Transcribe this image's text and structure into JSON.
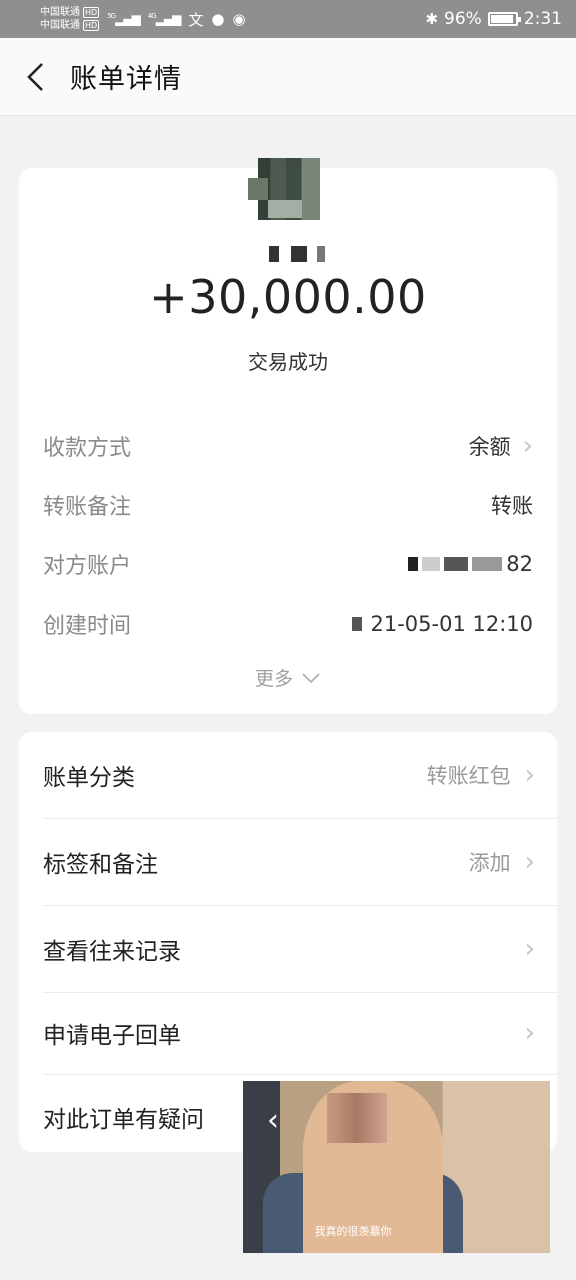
{
  "status_bar": {
    "carrier1": "中国联通",
    "carrier2": "中国联通",
    "hd": "HD",
    "sig1": "5G",
    "sig2": "4G",
    "battery": "96%",
    "time": "2:31"
  },
  "header": {
    "title": "账单详情"
  },
  "summary": {
    "amount": "+30,000.00",
    "status": "交易成功"
  },
  "details": [
    {
      "label": "收款方式",
      "value": "余额"
    },
    {
      "label": "转账备注",
      "value": "转账"
    },
    {
      "label": "对方账户",
      "value": "82"
    },
    {
      "label": "创建时间",
      "value": "21-05-01 12:10"
    }
  ],
  "more_label": "更多",
  "actions": [
    {
      "label": "账单分类",
      "value": "转账红包"
    },
    {
      "label": "标签和备注",
      "value": "添加"
    },
    {
      "label": "查看往来记录",
      "value": ""
    },
    {
      "label": "申请电子回单",
      "value": ""
    },
    {
      "label": "对此订单有疑问",
      "value": ""
    }
  ],
  "pip": {
    "subtitle": "我真的很羡慕你"
  }
}
